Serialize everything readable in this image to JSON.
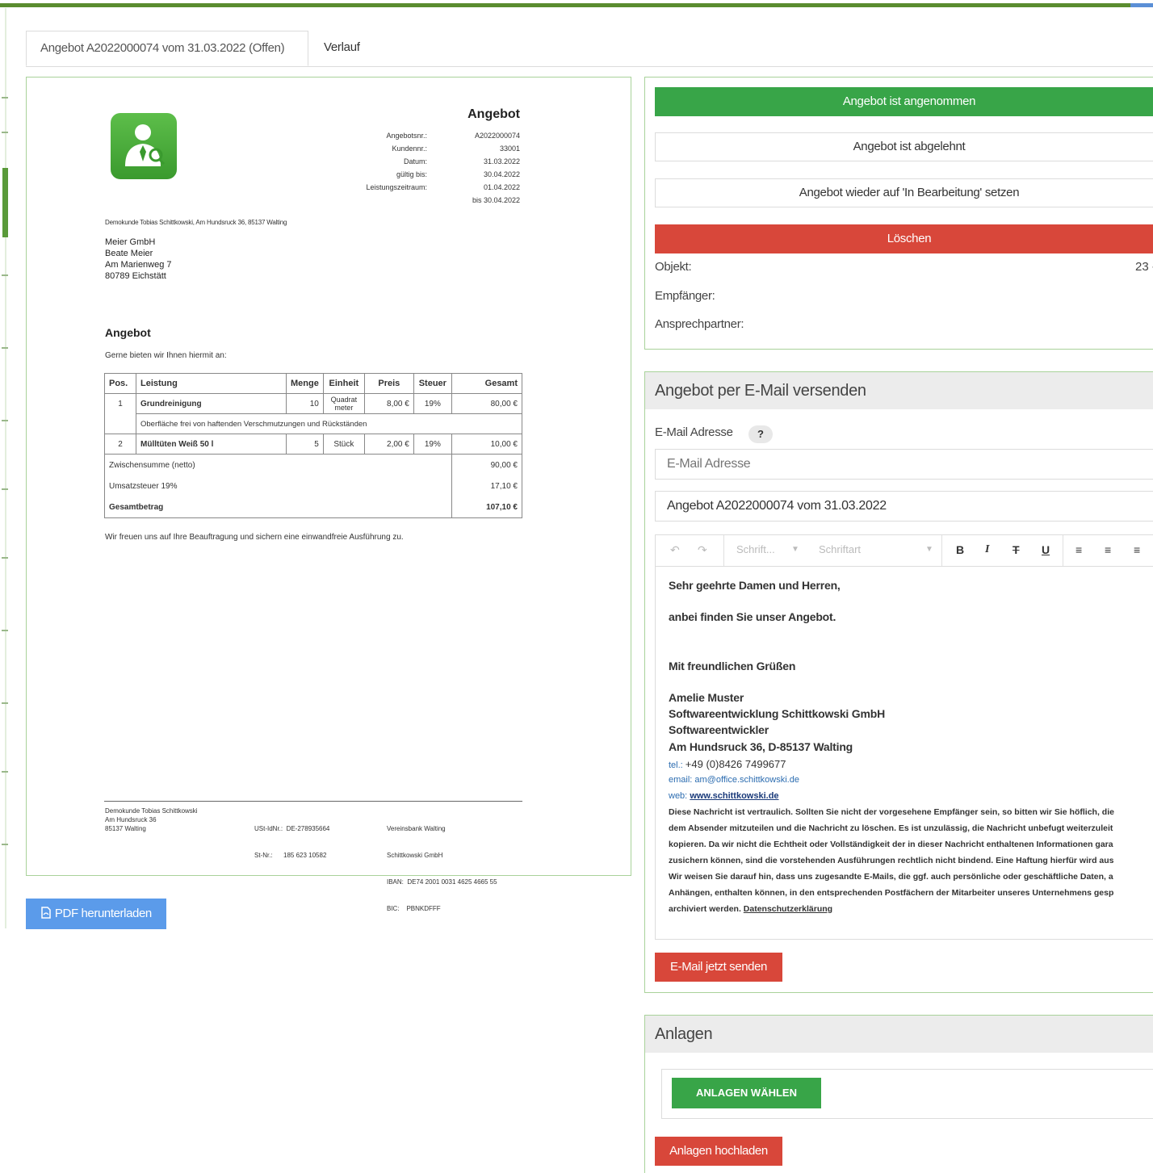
{
  "tabs": {
    "active": "Angebot A2022000074 vom 31.03.2022 (Offen)",
    "history": "Verlauf"
  },
  "document": {
    "title": "Angebot",
    "meta_labels": [
      "Angebotsnr.:",
      "Kundennr.:",
      "Datum:",
      "gültig bis:",
      "Leistungszeitraum:",
      ""
    ],
    "meta_values": [
      "A2022000074",
      "33001",
      "31.03.2022",
      "30.04.2022",
      "01.04.2022",
      "bis 30.04.2022"
    ],
    "sender_line": "Demokunde Tobias Schittkowski, Am Hundsruck 36, 85137 Walting",
    "recipient": [
      "Meier GmbH",
      "Beate Meier",
      "Am Marienweg 7",
      "80789 Eichstätt"
    ],
    "heading": "Angebot",
    "intro": "Gerne bieten wir Ihnen hiermit an:",
    "table_headers": [
      "Pos.",
      "Leistung",
      "Menge",
      "Einheit",
      "Preis",
      "Steuer",
      "Gesamt"
    ],
    "rows": [
      {
        "pos": "1",
        "leistung": "Grundreinigung",
        "menge": "10",
        "einheit": "Quadrat meter",
        "preis": "8,00 €",
        "steuer": "19%",
        "gesamt": "80,00 €"
      },
      {
        "pos": "2",
        "leistung": "Mülltüten Weiß 50 l",
        "menge": "5",
        "einheit": "Stück",
        "preis": "2,00 €",
        "steuer": "19%",
        "gesamt": "10,00 €"
      }
    ],
    "row1_description": "Oberfläche frei von haftenden Verschmutzungen und Rückständen",
    "subtotal_label": "Zwischensumme (netto)",
    "subtotal_value": "90,00 €",
    "vat_label": "Umsatzsteuer 19%",
    "vat_value": "17,10 €",
    "total_label": "Gesamtbetrag",
    "total_value": "107,10 €",
    "thanks": "Wir freuen uns auf Ihre Beauftragung und sichern eine einwandfreie Ausführung zu.",
    "footer_col1": [
      "Demokunde Tobias Schittkowski",
      "Am Hundsruck 36",
      "85137 Walting"
    ],
    "footer_col2": [
      "USt-IdNr.:  DE-278935664",
      "St-Nr.:      185 623 10582"
    ],
    "footer_col3": [
      "Vereinsbank Walting",
      "Schittkowski GmbH",
      "IBAN:  DE74 2001 0031 4625 4665 55",
      "BIC:    PBNKDFFF"
    ]
  },
  "pdf_button": "PDF herunterladen",
  "actions": {
    "accepted": "Angebot ist angenommen",
    "declined": "Angebot ist abgelehnt",
    "reset": "Angebot wieder auf 'In Bearbeitung' setzen",
    "delete": "Löschen",
    "objekt_label": "Objekt:",
    "objekt_value": "23 -",
    "empfaenger_label": "Empfänger:",
    "ansprechpartner_label": "Ansprechpartner:"
  },
  "email": {
    "title": "Angebot per E-Mail versenden",
    "address_label": "E-Mail Adresse",
    "help": "?",
    "address_placeholder": "E-Mail Adresse",
    "subject": "Angebot A2022000074 vom 31.03.2022",
    "toolbar_font_size": "Schrift...",
    "toolbar_font": "Schriftart",
    "greeting": "Sehr geehrte Damen und Herren,",
    "line1": "anbei finden Sie unser Angebot.",
    "closing": "Mit freundlichen Grüßen",
    "sig_name": "Amelie Muster",
    "sig_company": "Softwareentwicklung Schittkowski GmbH",
    "sig_role": "Softwareentwickler",
    "sig_address": "Am Hundsruck 36, D-85137 Walting",
    "tel_label": "tel.:",
    "tel_value": "+49 (0)8426 7499677",
    "email_label": "email:",
    "email_value": "am@office.schittkowski.de",
    "web_label": "web:",
    "web_value": "www.schittkowski.de",
    "disclaimer": [
      "Diese Nachricht ist vertraulich. Sollten Sie nicht der vorgesehene Empfänger sein, so bitten wir Sie höflich, die",
      "dem Absender mitzuteilen und die Nachricht zu löschen. Es ist unzulässig, die Nachricht unbefugt weiterzuleit",
      "kopieren. Da wir nicht die Echtheit oder Vollständigkeit der in dieser Nachricht enthaltenen Informationen gara",
      "zusichern können, sind die vorstehenden Ausführungen rechtlich nicht bindend. Eine Haftung hierfür wird aus",
      "Wir weisen Sie darauf hin, dass uns zugesandte E-Mails, die ggf. auch persönliche oder geschäftliche Daten, a",
      "Anhängen, enthalten können, in den entsprechenden Postfächern der Mitarbeiter unseres Unternehmens gesp"
    ],
    "disclaimer_last": "archiviert werden.",
    "privacy_link": "Datenschutzerklärung",
    "send_button": "E-Mail jetzt senden"
  },
  "attachments": {
    "title": "Anlagen",
    "choose_button": "ANLAGEN WÄHLEN",
    "upload_button": "Anlagen hochladen"
  },
  "colors": {
    "green": "#38a548",
    "red": "#d8473a",
    "blue": "#5b9bea",
    "border_green": "#a9d29a"
  }
}
